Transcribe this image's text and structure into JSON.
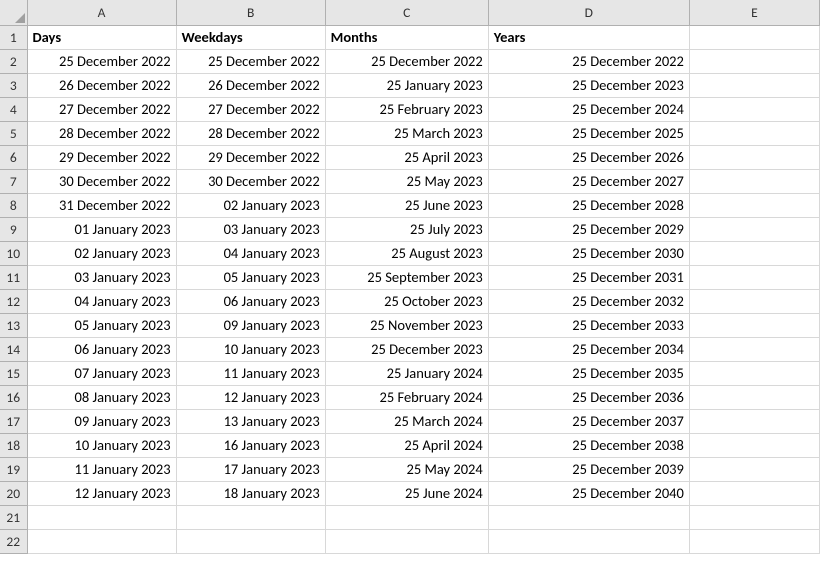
{
  "columns": [
    "A",
    "B",
    "C",
    "D",
    "E"
  ],
  "row_count": 22,
  "headers": {
    "A": "Days",
    "B": "Weekdays",
    "C": "Months",
    "D": "Years",
    "E": ""
  },
  "rows": [
    {
      "A": "25 December 2022",
      "B": "25 December 2022",
      "C": "25 December 2022",
      "D": "25 December 2022",
      "E": ""
    },
    {
      "A": "26 December 2022",
      "B": "26 December 2022",
      "C": "25 January 2023",
      "D": "25 December 2023",
      "E": ""
    },
    {
      "A": "27 December 2022",
      "B": "27 December 2022",
      "C": "25 February 2023",
      "D": "25 December 2024",
      "E": ""
    },
    {
      "A": "28 December 2022",
      "B": "28 December 2022",
      "C": "25 March 2023",
      "D": "25 December 2025",
      "E": ""
    },
    {
      "A": "29 December 2022",
      "B": "29 December 2022",
      "C": "25 April 2023",
      "D": "25 December 2026",
      "E": ""
    },
    {
      "A": "30 December 2022",
      "B": "30 December 2022",
      "C": "25 May 2023",
      "D": "25 December 2027",
      "E": ""
    },
    {
      "A": "31 December 2022",
      "B": "02 January 2023",
      "C": "25 June 2023",
      "D": "25 December 2028",
      "E": ""
    },
    {
      "A": "01 January 2023",
      "B": "03 January 2023",
      "C": "25 July 2023",
      "D": "25 December 2029",
      "E": ""
    },
    {
      "A": "02 January 2023",
      "B": "04 January 2023",
      "C": "25 August 2023",
      "D": "25 December 2030",
      "E": ""
    },
    {
      "A": "03 January 2023",
      "B": "05 January 2023",
      "C": "25 September 2023",
      "D": "25 December 2031",
      "E": ""
    },
    {
      "A": "04 January 2023",
      "B": "06 January 2023",
      "C": "25 October 2023",
      "D": "25 December 2032",
      "E": ""
    },
    {
      "A": "05 January 2023",
      "B": "09 January 2023",
      "C": "25 November 2023",
      "D": "25 December 2033",
      "E": ""
    },
    {
      "A": "06 January 2023",
      "B": "10 January 2023",
      "C": "25 December 2023",
      "D": "25 December 2034",
      "E": ""
    },
    {
      "A": "07 January 2023",
      "B": "11 January 2023",
      "C": "25 January 2024",
      "D": "25 December 2035",
      "E": ""
    },
    {
      "A": "08 January 2023",
      "B": "12 January 2023",
      "C": "25 February 2024",
      "D": "25 December 2036",
      "E": ""
    },
    {
      "A": "09 January 2023",
      "B": "13 January 2023",
      "C": "25 March 2024",
      "D": "25 December 2037",
      "E": ""
    },
    {
      "A": "10 January 2023",
      "B": "16 January 2023",
      "C": "25 April 2024",
      "D": "25 December 2038",
      "E": ""
    },
    {
      "A": "11 January 2023",
      "B": "17 January 2023",
      "C": "25 May 2024",
      "D": "25 December 2039",
      "E": ""
    },
    {
      "A": "12 January 2023",
      "B": "18 January 2023",
      "C": "25 June 2024",
      "D": "25 December 2040",
      "E": ""
    }
  ]
}
